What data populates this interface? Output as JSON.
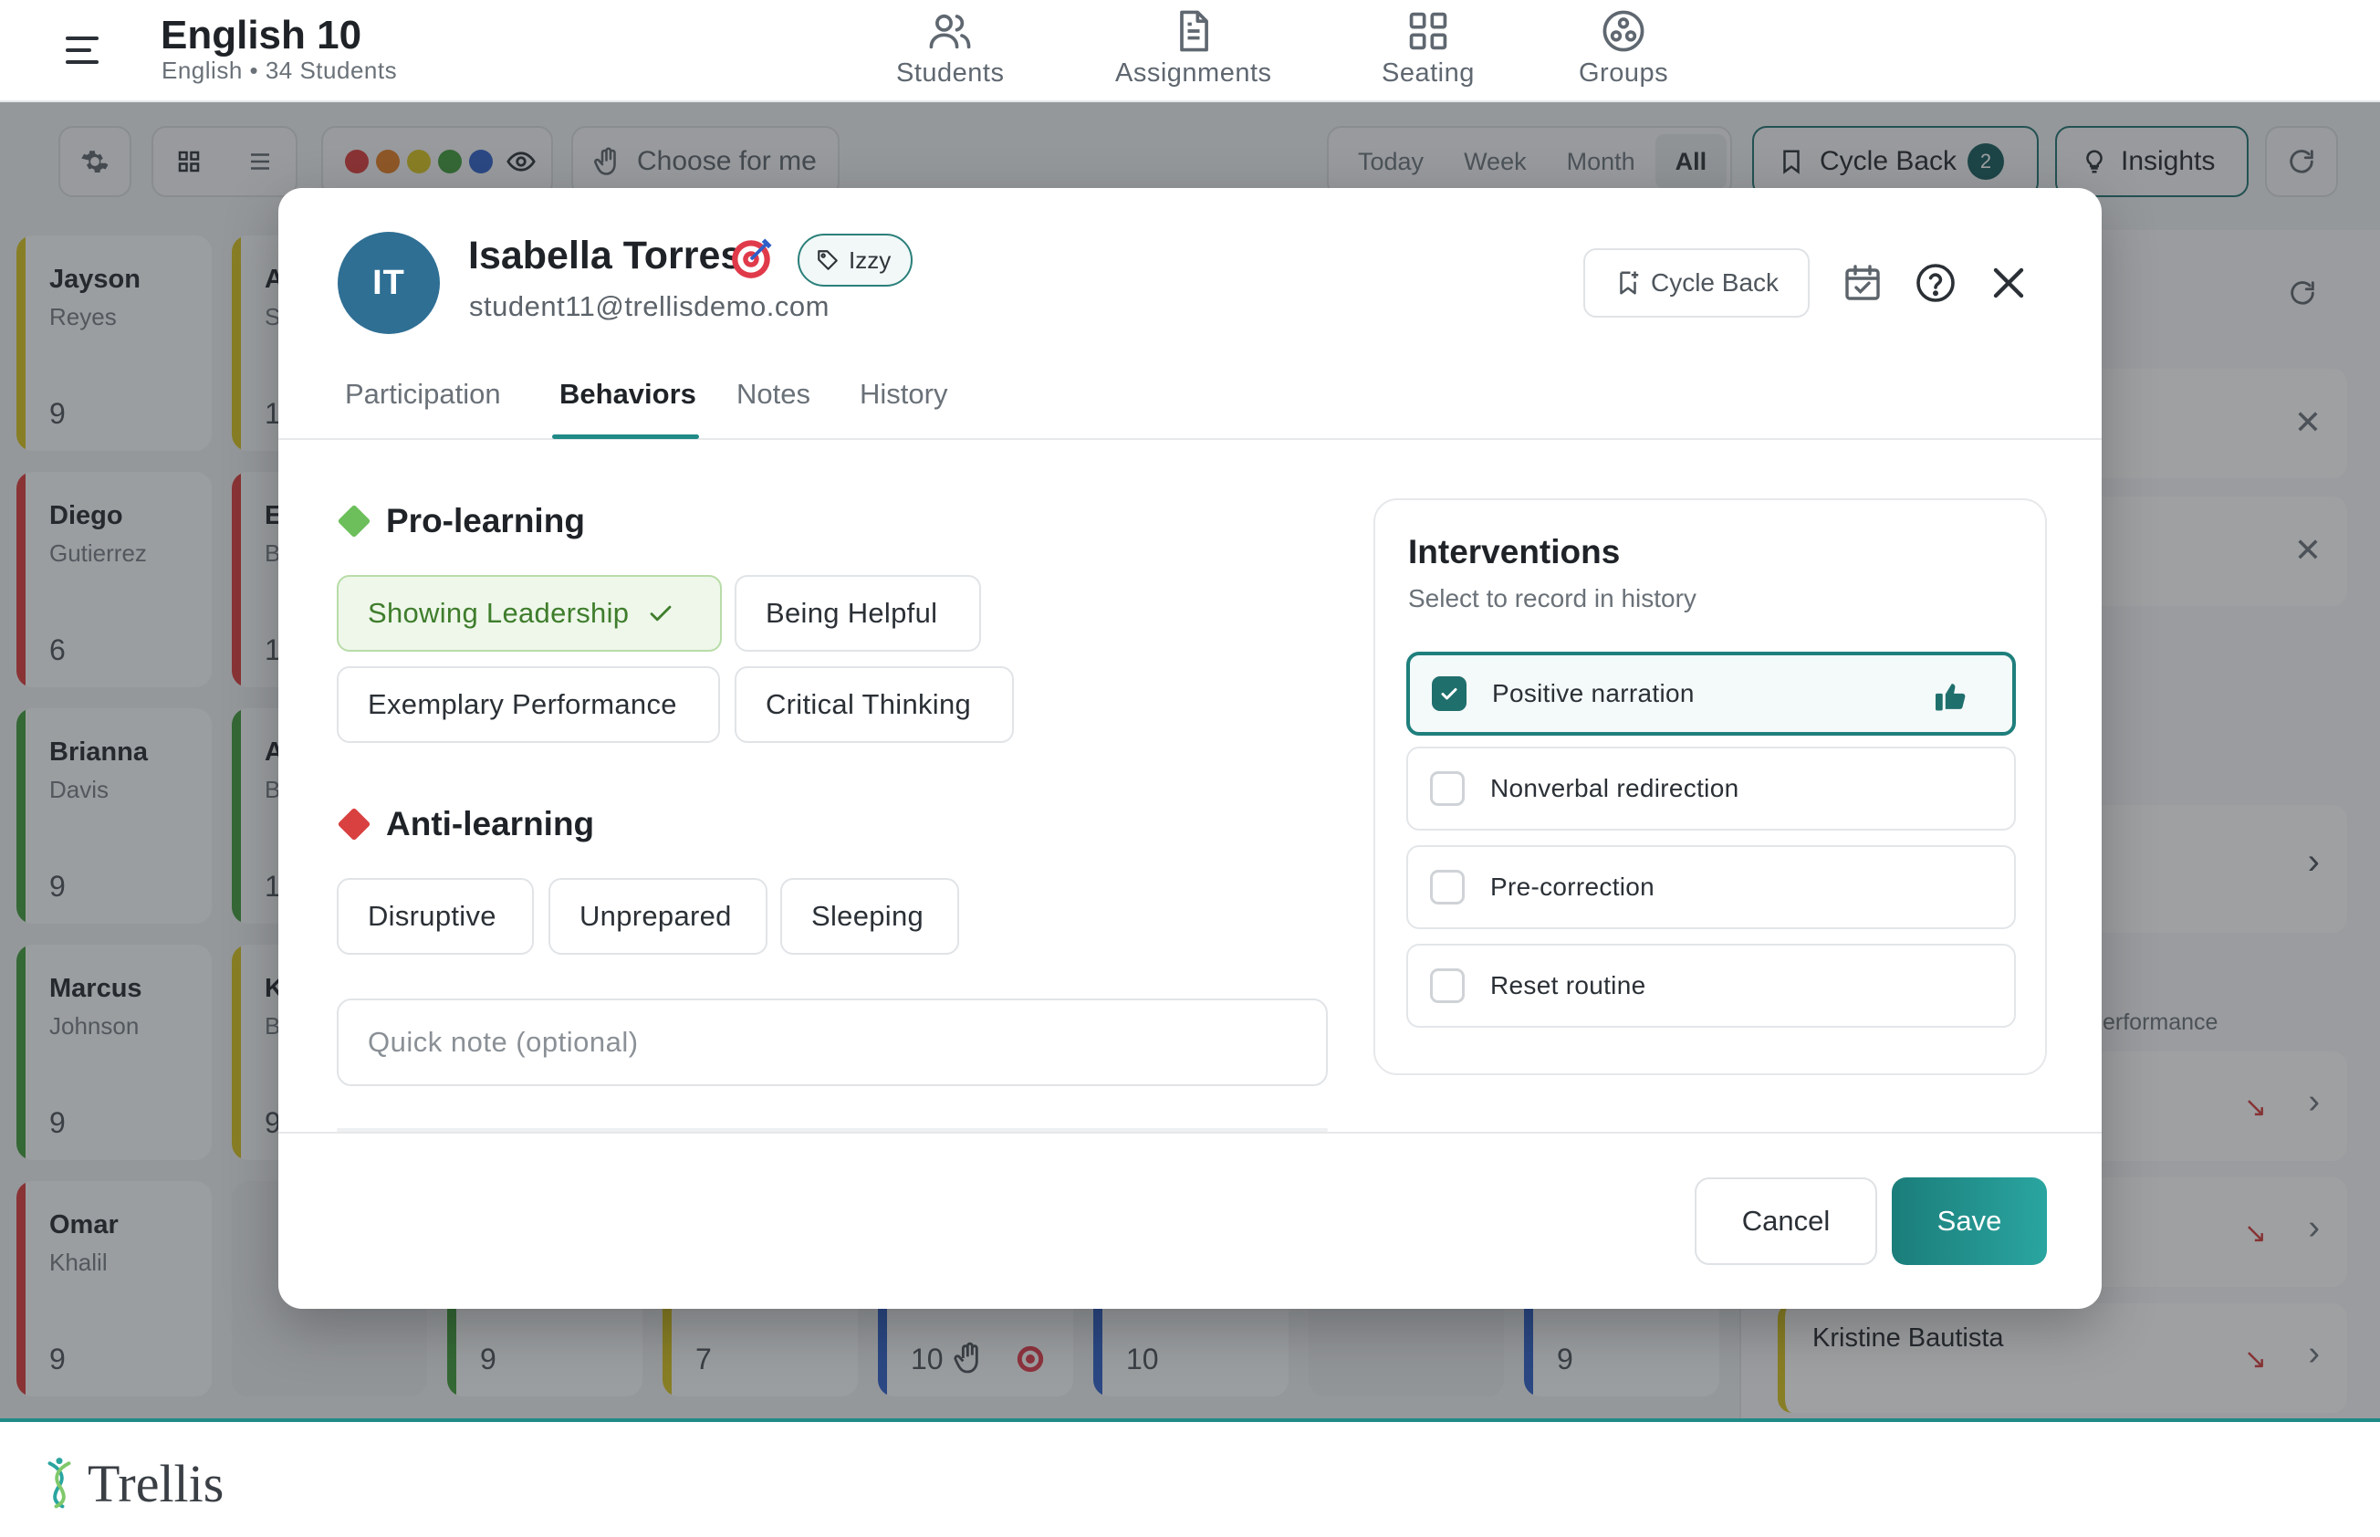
{
  "header": {
    "class_title": "English 10",
    "class_subtitle": "English • 34 Students",
    "nav": [
      {
        "label": "Students",
        "icon": "users-icon"
      },
      {
        "label": "Assignments",
        "icon": "document-icon"
      },
      {
        "label": "Seating",
        "icon": "grid-icon"
      },
      {
        "label": "Groups",
        "icon": "groups-icon"
      }
    ]
  },
  "toolbar": {
    "choose_label": "Choose for me",
    "ranges": [
      "Today",
      "Week",
      "Month",
      "All"
    ],
    "active_range": "All",
    "cycle_back_label": "Cycle Back",
    "cycle_back_count": "2",
    "insights_label": "Insights",
    "color_dots": [
      "#d93a3a",
      "#e27a1f",
      "#d8c21c",
      "#3f9a3a",
      "#2f5fc8"
    ]
  },
  "background": {
    "students": [
      {
        "first": "Jayson",
        "last": "Reyes",
        "count": "9",
        "color": "#d8c21c"
      },
      {
        "first": "Diego",
        "last": "Gutierrez",
        "count": "6",
        "color": "#d93a3a"
      },
      {
        "first": "Brianna",
        "last": "Davis",
        "count": "9",
        "color": "#3f9a3a"
      },
      {
        "first": "Marcus",
        "last": "Johnson",
        "count": "9",
        "color": "#3f9a3a"
      },
      {
        "first": "Omar",
        "last": "Khalil",
        "count": "9",
        "color": "#d93a3a"
      }
    ],
    "col2": [
      {
        "first": "A",
        "last": "S",
        "count": "1",
        "color": "#d8c21c"
      },
      {
        "first": "E",
        "last": "B",
        "count": "1",
        "color": "#d93a3a"
      },
      {
        "first": "A",
        "last": "B",
        "count": "1",
        "color": "#3f9a3a"
      },
      {
        "first": "K",
        "last": "B",
        "count": "9",
        "color": "#d8c21c"
      }
    ],
    "bottom_counts": [
      {
        "count": "9",
        "color": "#3f9a3a"
      },
      {
        "count": "7",
        "color": "#d8c21c"
      },
      {
        "count": "10",
        "color": "#2f5fc8"
      },
      {
        "count": "10",
        "color": "#2f5fc8"
      },
      {
        "count": "9",
        "color": "#2f5fc8"
      }
    ],
    "right_panel_partial": "erformance",
    "right_panel_student": "Kristine Bautista"
  },
  "modal": {
    "avatar_initials": "IT",
    "student_name": "Isabella Torres",
    "nickname": "Izzy",
    "email": "student11@trellisdemo.com",
    "cycle_back_label": "Cycle Back",
    "tabs": [
      "Participation",
      "Behaviors",
      "Notes",
      "History"
    ],
    "active_tab": "Behaviors",
    "pro_learning": {
      "title": "Pro-learning",
      "color": "#6cbf5a",
      "chips": [
        {
          "label": "Showing Leadership",
          "selected": true
        },
        {
          "label": "Being Helpful",
          "selected": false
        },
        {
          "label": "Exemplary Performance",
          "selected": false
        },
        {
          "label": "Critical Thinking",
          "selected": false
        }
      ]
    },
    "anti_learning": {
      "title": "Anti-learning",
      "color": "#d94040",
      "chips": [
        {
          "label": "Disruptive",
          "selected": false
        },
        {
          "label": "Unprepared",
          "selected": false
        },
        {
          "label": "Sleeping",
          "selected": false
        }
      ]
    },
    "quick_note": {
      "value": "",
      "placeholder": "Quick note (optional)"
    },
    "interventions": {
      "title": "Interventions",
      "subtitle": "Select to record in history",
      "options": [
        {
          "label": "Positive narration",
          "checked": true
        },
        {
          "label": "Nonverbal redirection",
          "checked": false
        },
        {
          "label": "Pre-correction",
          "checked": false
        },
        {
          "label": "Reset routine",
          "checked": false
        }
      ]
    },
    "cancel_label": "Cancel",
    "save_label": "Save"
  },
  "footer": {
    "brand": "Trellis"
  }
}
